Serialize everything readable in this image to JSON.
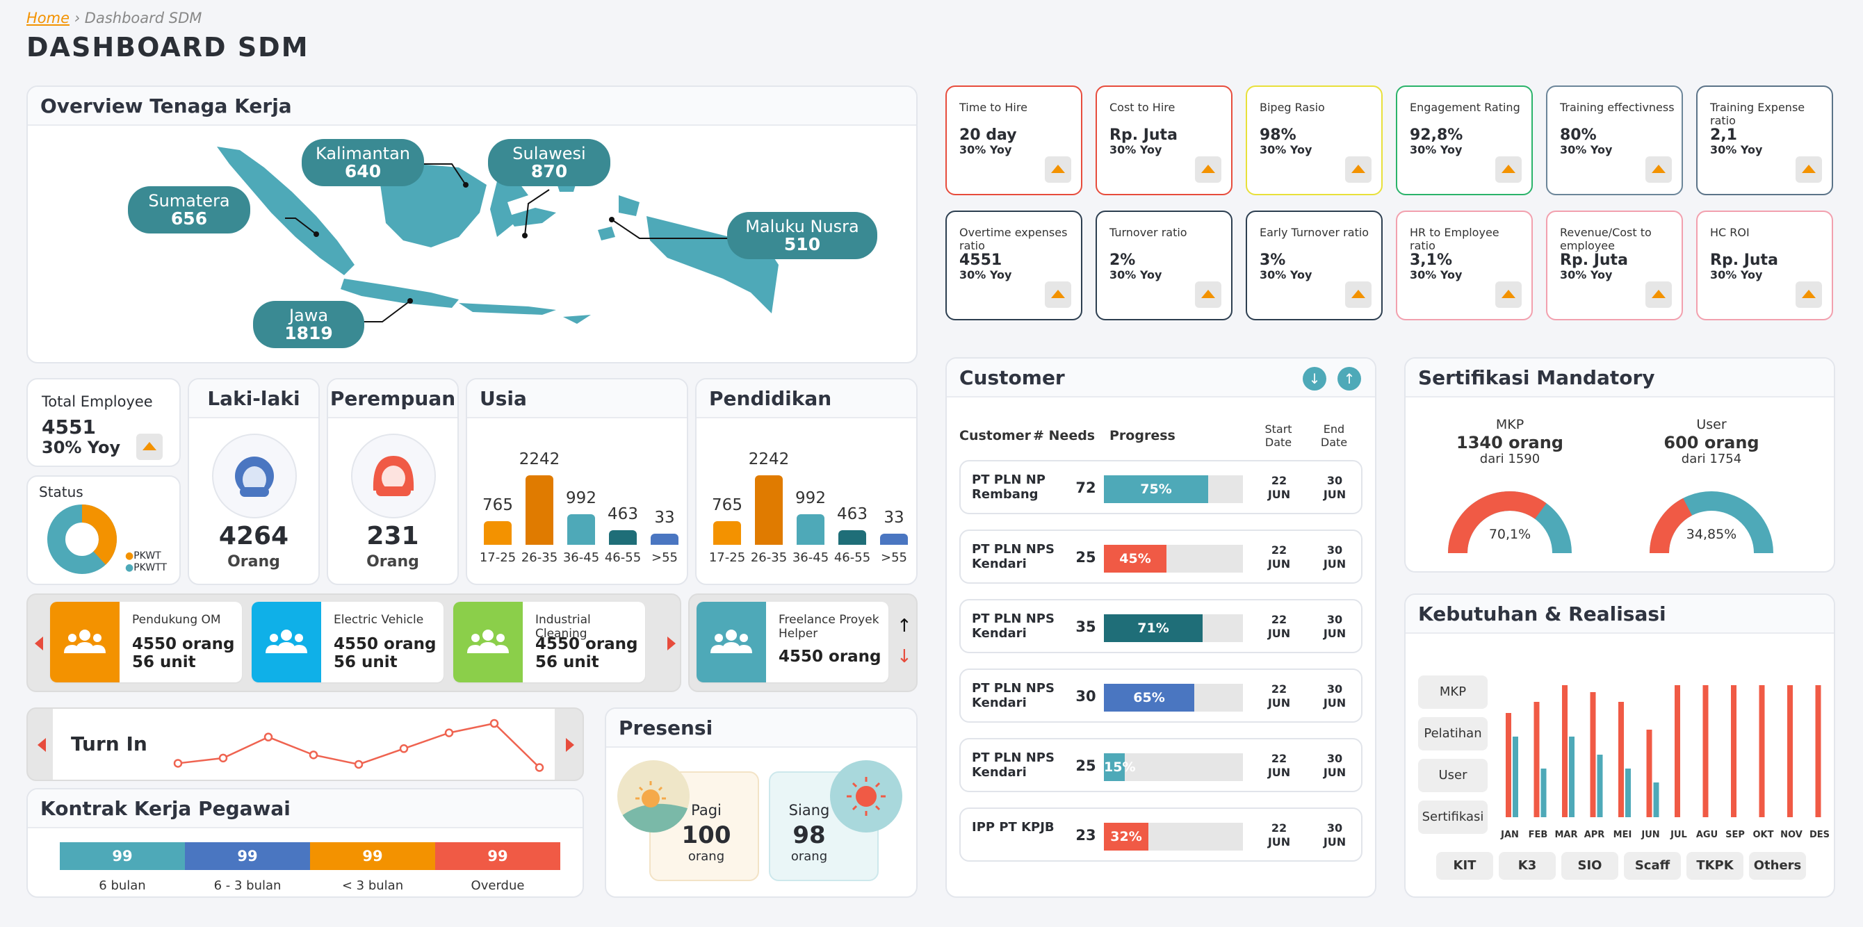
{
  "breadcrumb": {
    "home": "Home",
    "sep": "›",
    "current": "Dashboard SDM"
  },
  "page_title": "DASHBOARD SDM",
  "overview": {
    "title": "Overview Tenaga Kerja",
    "regions": [
      {
        "name": "Sumatera",
        "value": "656"
      },
      {
        "name": "Kalimantan",
        "value": "640"
      },
      {
        "name": "Sulawesi",
        "value": "870"
      },
      {
        "name": "Maluku Nusra",
        "value": "510"
      },
      {
        "name": "Jawa",
        "value": "1819"
      }
    ],
    "map_color": "#4ea9b8",
    "bubble_color": "#3a8a93"
  },
  "kpis": [
    {
      "title": "Time to Hire",
      "value": "20 day",
      "yoy": "30% Yoy",
      "color": "#e74c3c"
    },
    {
      "title": "Cost to Hire",
      "value": "Rp. Juta",
      "yoy": "30% Yoy",
      "color": "#e74c3c"
    },
    {
      "title": "Bipeg Rasio",
      "value": "98%",
      "yoy": "30% Yoy",
      "color": "#e8e03a"
    },
    {
      "title": "Engagement Rating",
      "value": "92,8%",
      "yoy": "30% Yoy",
      "color": "#2ab36a"
    },
    {
      "title": "Training effectivness",
      "value": "80%",
      "yoy": "30% Yoy",
      "color": "#6b8599"
    },
    {
      "title": "Training Expense ratio",
      "value": "2,1",
      "yoy": "30% Yoy",
      "color": "#5b7388"
    },
    {
      "title": "Overtime expenses ratio",
      "value": "4551",
      "yoy": "30% Yoy",
      "color": "#2c3e50"
    },
    {
      "title": "Turnover ratio",
      "value": "2%",
      "yoy": "30% Yoy",
      "color": "#2c3e50"
    },
    {
      "title": "Early Turnover ratio",
      "value": "3%",
      "yoy": "30% Yoy",
      "color": "#2c3e50"
    },
    {
      "title": "HR to Employee ratio",
      "value": "3,1%",
      "yoy": "30% Yoy",
      "color": "#f2a0ae"
    },
    {
      "title": "Revenue/Cost to employee",
      "value": "Rp. Juta",
      "yoy": "30% Yoy",
      "color": "#f2a0ae"
    },
    {
      "title": "HC ROI",
      "value": "Rp. Juta",
      "yoy": "30% Yoy",
      "color": "#f2a0ae"
    }
  ],
  "total_employee": {
    "label": "Total Employee",
    "value": "4551",
    "yoy": "30% Yoy"
  },
  "status": {
    "label": "Status",
    "legend": [
      "PKWT",
      "PKWTT"
    ],
    "pkwt_share": 0.38,
    "colors": [
      "#f39200",
      "#4ea9b8"
    ]
  },
  "gender": {
    "male": {
      "label": "Laki-laki",
      "value": "4264",
      "unit": "Orang"
    },
    "female": {
      "label": "Perempuan",
      "value": "231",
      "unit": "Orang"
    }
  },
  "usia": {
    "title": "Usia",
    "categories": [
      "17-25",
      "26-35",
      "36-45",
      "46-55",
      ">55"
    ],
    "values": [
      765,
      2242,
      992,
      463,
      33
    ],
    "colors": [
      "#f39200",
      "#e07b00",
      "#4ea9b8",
      "#1f6e78",
      "#4a76c1"
    ]
  },
  "pendidikan": {
    "title": "Pendidikan",
    "categories": [
      "17-25",
      "26-35",
      "36-45",
      "46-55",
      ">55"
    ],
    "values": [
      765,
      2242,
      992,
      463,
      33
    ],
    "colors": [
      "#f39200",
      "#e07b00",
      "#4ea9b8",
      "#1f6e78",
      "#4a76c1"
    ]
  },
  "depts": [
    {
      "name": "Pendukung OM",
      "orang": "4550 orang",
      "unit": "56 unit",
      "color": "#f39200"
    },
    {
      "name": "Electric Vehicle",
      "orang": "4550 orang",
      "unit": "56 unit",
      "color": "#0fb0e8"
    },
    {
      "name": "Industrial Cleaning",
      "orang": "4550 orang",
      "unit": "56 unit",
      "color": "#8bcf4a"
    }
  ],
  "freelance": {
    "name": "Freelance Proyek Helper",
    "orang": "4550 orang",
    "color": "#4ea9b8"
  },
  "turn_in": {
    "label": "Turn In",
    "values": [
      7,
      6.5,
      4.5,
      6.2,
      7.1,
      5.6,
      4.1,
      3.2,
      7.4
    ],
    "color": "#ef6350"
  },
  "presensi": {
    "title": "Presensi",
    "pagi": {
      "label": "Pagi",
      "value": "100",
      "unit": "orang"
    },
    "siang": {
      "label": "Siang",
      "value": "98",
      "unit": "orang"
    }
  },
  "kontrak": {
    "title": "Kontrak Kerja Pegawai",
    "segments": [
      {
        "value": "99",
        "label": "6 bulan",
        "color": "#4ea9b8"
      },
      {
        "value": "99",
        "label": "6 - 3 bulan",
        "color": "#4a76c1"
      },
      {
        "value": "99",
        "label": "< 3 bulan",
        "color": "#f39200"
      },
      {
        "value": "99",
        "label": "Overdue",
        "color": "#f05a45"
      }
    ]
  },
  "customer": {
    "title": "Customer",
    "headers": {
      "customer": "Customer",
      "needs": "# Needs",
      "progress": "Progress",
      "start": "Start Date",
      "end": "End Date"
    },
    "rows": [
      {
        "name": "PT PLN NP Rembang",
        "needs": "72",
        "progress": 75,
        "label": "75%",
        "color": "#4ea9b8",
        "start": "22 JUN",
        "end": "30 JUN"
      },
      {
        "name": "PT PLN NPS Kendari",
        "needs": "25",
        "progress": 45,
        "label": "45%",
        "color": "#f05a45",
        "start": "22 JUN",
        "end": "30 JUN"
      },
      {
        "name": "PT PLN NPS Kendari",
        "needs": "35",
        "progress": 71,
        "label": "71%",
        "color": "#1f6e78",
        "start": "22 JUN",
        "end": "30 JUN"
      },
      {
        "name": "PT PLN NPS Kendari",
        "needs": "30",
        "progress": 65,
        "label": "65%",
        "color": "#4a76c1",
        "start": "22 JUN",
        "end": "30 JUN"
      },
      {
        "name": "PT PLN NPS Kendari",
        "needs": "25",
        "progress": 15,
        "label": "15%",
        "color": "#4ea9b8",
        "start": "22 JUN",
        "end": "30 JUN"
      },
      {
        "name": "IPP PT KPJB",
        "needs": "23",
        "progress": 32,
        "label": "32%",
        "color": "#f05a45",
        "start": "22 JUN",
        "end": "30 JUN"
      }
    ]
  },
  "sertifikasi": {
    "title": "Sertifikasi Mandatory",
    "gauges": [
      {
        "label": "MKP",
        "value": "1340 orang",
        "sub": "dari 1590",
        "pct_label": "70,1%",
        "pct": 0.701
      },
      {
        "label": "User",
        "value": "600 orang",
        "sub": "dari 1754",
        "pct_label": "34,85%",
        "pct": 0.3485
      }
    ],
    "colors": [
      "#f05a45",
      "#4ea9b8"
    ]
  },
  "kebutuhan": {
    "title": "Kebutuhan & Realisasi",
    "side_buttons": [
      "MKP",
      "Pelatihan",
      "User",
      "Sertifikasi"
    ],
    "bottom_buttons": [
      "KIT",
      "K3",
      "SIO",
      "Scaff",
      "TKPK",
      "Others"
    ],
    "chart_data": {
      "type": "bar",
      "categories": [
        "JAN",
        "FEB",
        "MAR",
        "APR",
        "MEI",
        "JUN",
        "JUL",
        "AGU",
        "SEP",
        "OKT",
        "NOV",
        "DES"
      ],
      "series": [
        {
          "values": [
            75,
            83,
            95,
            90,
            83,
            63,
            95,
            95,
            95,
            95,
            95,
            95
          ],
          "color": "#f05a45"
        },
        {
          "values": [
            58,
            35,
            58,
            45,
            35,
            25,
            0,
            0,
            0,
            0,
            0,
            0
          ],
          "color": "#4ea9b8"
        }
      ],
      "ylim": [
        0,
        100
      ]
    }
  }
}
